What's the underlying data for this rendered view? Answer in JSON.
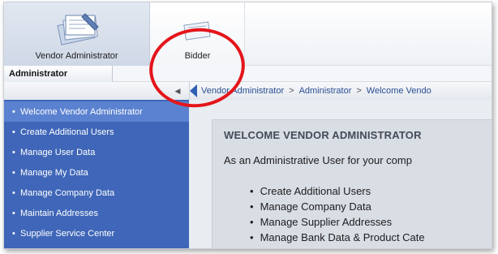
{
  "roles": [
    {
      "label": "Vendor Administrator",
      "icon": "vendor-admin-icon",
      "active": true
    },
    {
      "label": "Bidder",
      "icon": "bidder-icon",
      "active": false
    }
  ],
  "subtab": {
    "label": "Administrator"
  },
  "breadcrumb": {
    "items": [
      "Vendor Administrator",
      "Administrator",
      "Welcome Vendo"
    ],
    "separator": ">"
  },
  "sidebar": {
    "items": [
      {
        "label": "Welcome Vendor Administrator",
        "selected": true
      },
      {
        "label": "Create Additional Users"
      },
      {
        "label": "Manage User Data"
      },
      {
        "label": "Manage My Data"
      },
      {
        "label": "Manage Company Data"
      },
      {
        "label": "Maintain Addresses"
      },
      {
        "label": "Supplier Service Center"
      }
    ]
  },
  "main": {
    "title": "WELCOME VENDOR ADMINISTRATOR",
    "intro": "As an Administrative User for your comp",
    "bullets": [
      "Create Additional Users",
      "Manage Company Data",
      "Manage Supplier Addresses",
      "Manage Bank Data & Product Cate"
    ]
  },
  "colors": {
    "sidebar_bg": "#3f66b8",
    "sidebar_selected": "#5b82d0",
    "annotation": "#e4151a",
    "breadcrumb_link": "#2a4f93"
  }
}
